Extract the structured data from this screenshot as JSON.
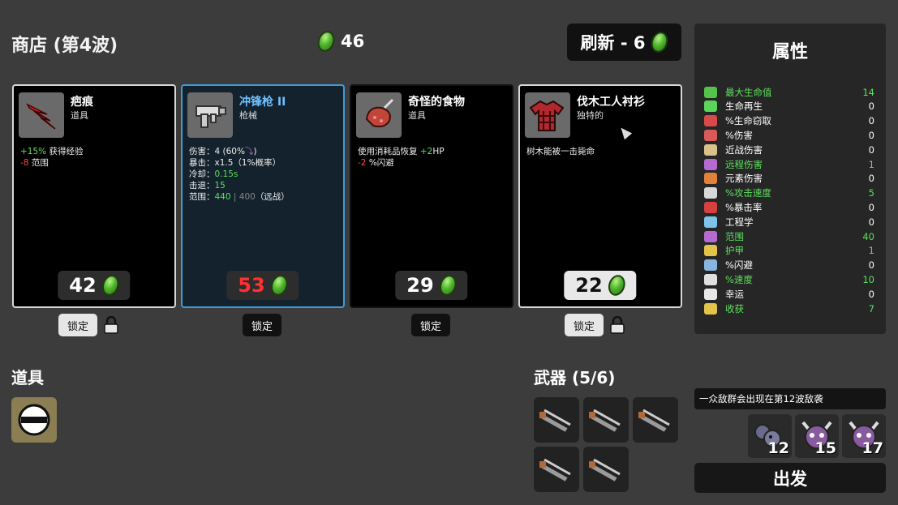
{
  "header": {
    "title": "商店 (第4波)",
    "coins": "46",
    "reroll_label": "刷新 - 6"
  },
  "cards": [
    {
      "name": "疤痕",
      "type": "道具",
      "icon": "scar-icon",
      "price": "42",
      "lock_label": "锁定",
      "lines": [
        {
          "prefix": "+15%",
          "prefix_color": "green",
          "text": " 获得经验"
        },
        {
          "prefix": "-8",
          "prefix_color": "red",
          "text": " 范围"
        }
      ]
    },
    {
      "name": "冲锋枪 II",
      "type": "枪械",
      "icon": "smg-icon",
      "price": "53",
      "lock_label": "锁定",
      "lines": [
        {
          "label": "伤害：",
          "value": "4 (60%",
          "suffix": ")"
        },
        {
          "label": "暴击：",
          "value": "x1.5（1%概率）"
        },
        {
          "label": "冷却：",
          "value": "0.15s",
          "value_color": "green"
        },
        {
          "label": "击退：",
          "value": "15",
          "value_color": "green"
        },
        {
          "label": "范围：",
          "value": "440",
          "value_color": "green",
          "extra": " | 400",
          "tail": "（远战）"
        }
      ]
    },
    {
      "name": "奇怪的食物",
      "type": "道具",
      "icon": "strange-food-icon",
      "price": "29",
      "lock_label": "锁定",
      "lines": [
        {
          "text": "使用消耗品恢复 ",
          "suffix": "+2",
          "suffix_color": "green",
          "tail": "HP"
        },
        {
          "prefix": "-2",
          "prefix_color": "red",
          "text": " %闪避"
        }
      ]
    },
    {
      "name": "伐木工人衬衫",
      "type": "独特的",
      "icon": "lumberjack-shirt-icon",
      "price": "22",
      "lock_label": "锁定",
      "lines": [
        {
          "text": "树木能被一击毙命"
        }
      ]
    }
  ],
  "items_section": {
    "title": "道具",
    "items": [
      {
        "icon": "helmet-icon"
      }
    ]
  },
  "weapons_section": {
    "title": "武器 (5/6)",
    "weapons": [
      {
        "icon": "smg-icon"
      },
      {
        "icon": "smg-icon"
      },
      {
        "icon": "smg-icon"
      },
      {
        "icon": "smg-icon"
      },
      {
        "icon": "smg-icon"
      }
    ]
  },
  "stats_panel": {
    "title": "属性",
    "rows": [
      {
        "label": "最大生命值",
        "value": "14",
        "highlight": true,
        "color": "#54c34a"
      },
      {
        "label": "生命再生",
        "value": "0",
        "highlight": false,
        "color": "#5bd45b"
      },
      {
        "label": "%生命窃取",
        "value": "0",
        "highlight": false,
        "color": "#d84a4a"
      },
      {
        "label": "%伤害",
        "value": "0",
        "highlight": false,
        "color": "#d85a5a"
      },
      {
        "label": "近战伤害",
        "value": "0",
        "highlight": false,
        "color": "#d9c28a"
      },
      {
        "label": "远程伤害",
        "value": "1",
        "highlight": true,
        "color": "#b46ad0"
      },
      {
        "label": "元素伤害",
        "value": "0",
        "highlight": false,
        "color": "#e0823a"
      },
      {
        "label": "%攻击速度",
        "value": "5",
        "highlight": true,
        "color": "#d8d8d8"
      },
      {
        "label": "%暴击率",
        "value": "0",
        "highlight": false,
        "color": "#d64040"
      },
      {
        "label": "工程学",
        "value": "0",
        "highlight": false,
        "color": "#7fc4e8"
      },
      {
        "label": "范围",
        "value": "40",
        "highlight": true,
        "color": "#b46ad0"
      },
      {
        "label": "护甲",
        "value": "1",
        "highlight": true,
        "color": "#e3c34a"
      },
      {
        "label": "%闪避",
        "value": "0",
        "highlight": false,
        "color": "#8ab4e0"
      },
      {
        "label": "%速度",
        "value": "10",
        "highlight": true,
        "color": "#e0e0e0"
      },
      {
        "label": "幸运",
        "value": "0",
        "highlight": false,
        "color": "#e8e8e8"
      },
      {
        "label": "收获",
        "value": "7",
        "highlight": true,
        "color": "#e3c34a"
      }
    ]
  },
  "wave_warning": "一众敌群会出现在第12波敌袭",
  "enemies": [
    {
      "count": "12",
      "icon": "bat-enemy-icon"
    },
    {
      "count": "15",
      "icon": "horned-skull-icon"
    },
    {
      "count": "17",
      "icon": "horned-skull-icon"
    }
  ],
  "go_label": "出发",
  "colors": {
    "background": "#3c3c3c",
    "card_bg": "#000000",
    "weapon_card_border": "#3f9bd7",
    "green": "#5de05d",
    "red": "#ff4848"
  }
}
